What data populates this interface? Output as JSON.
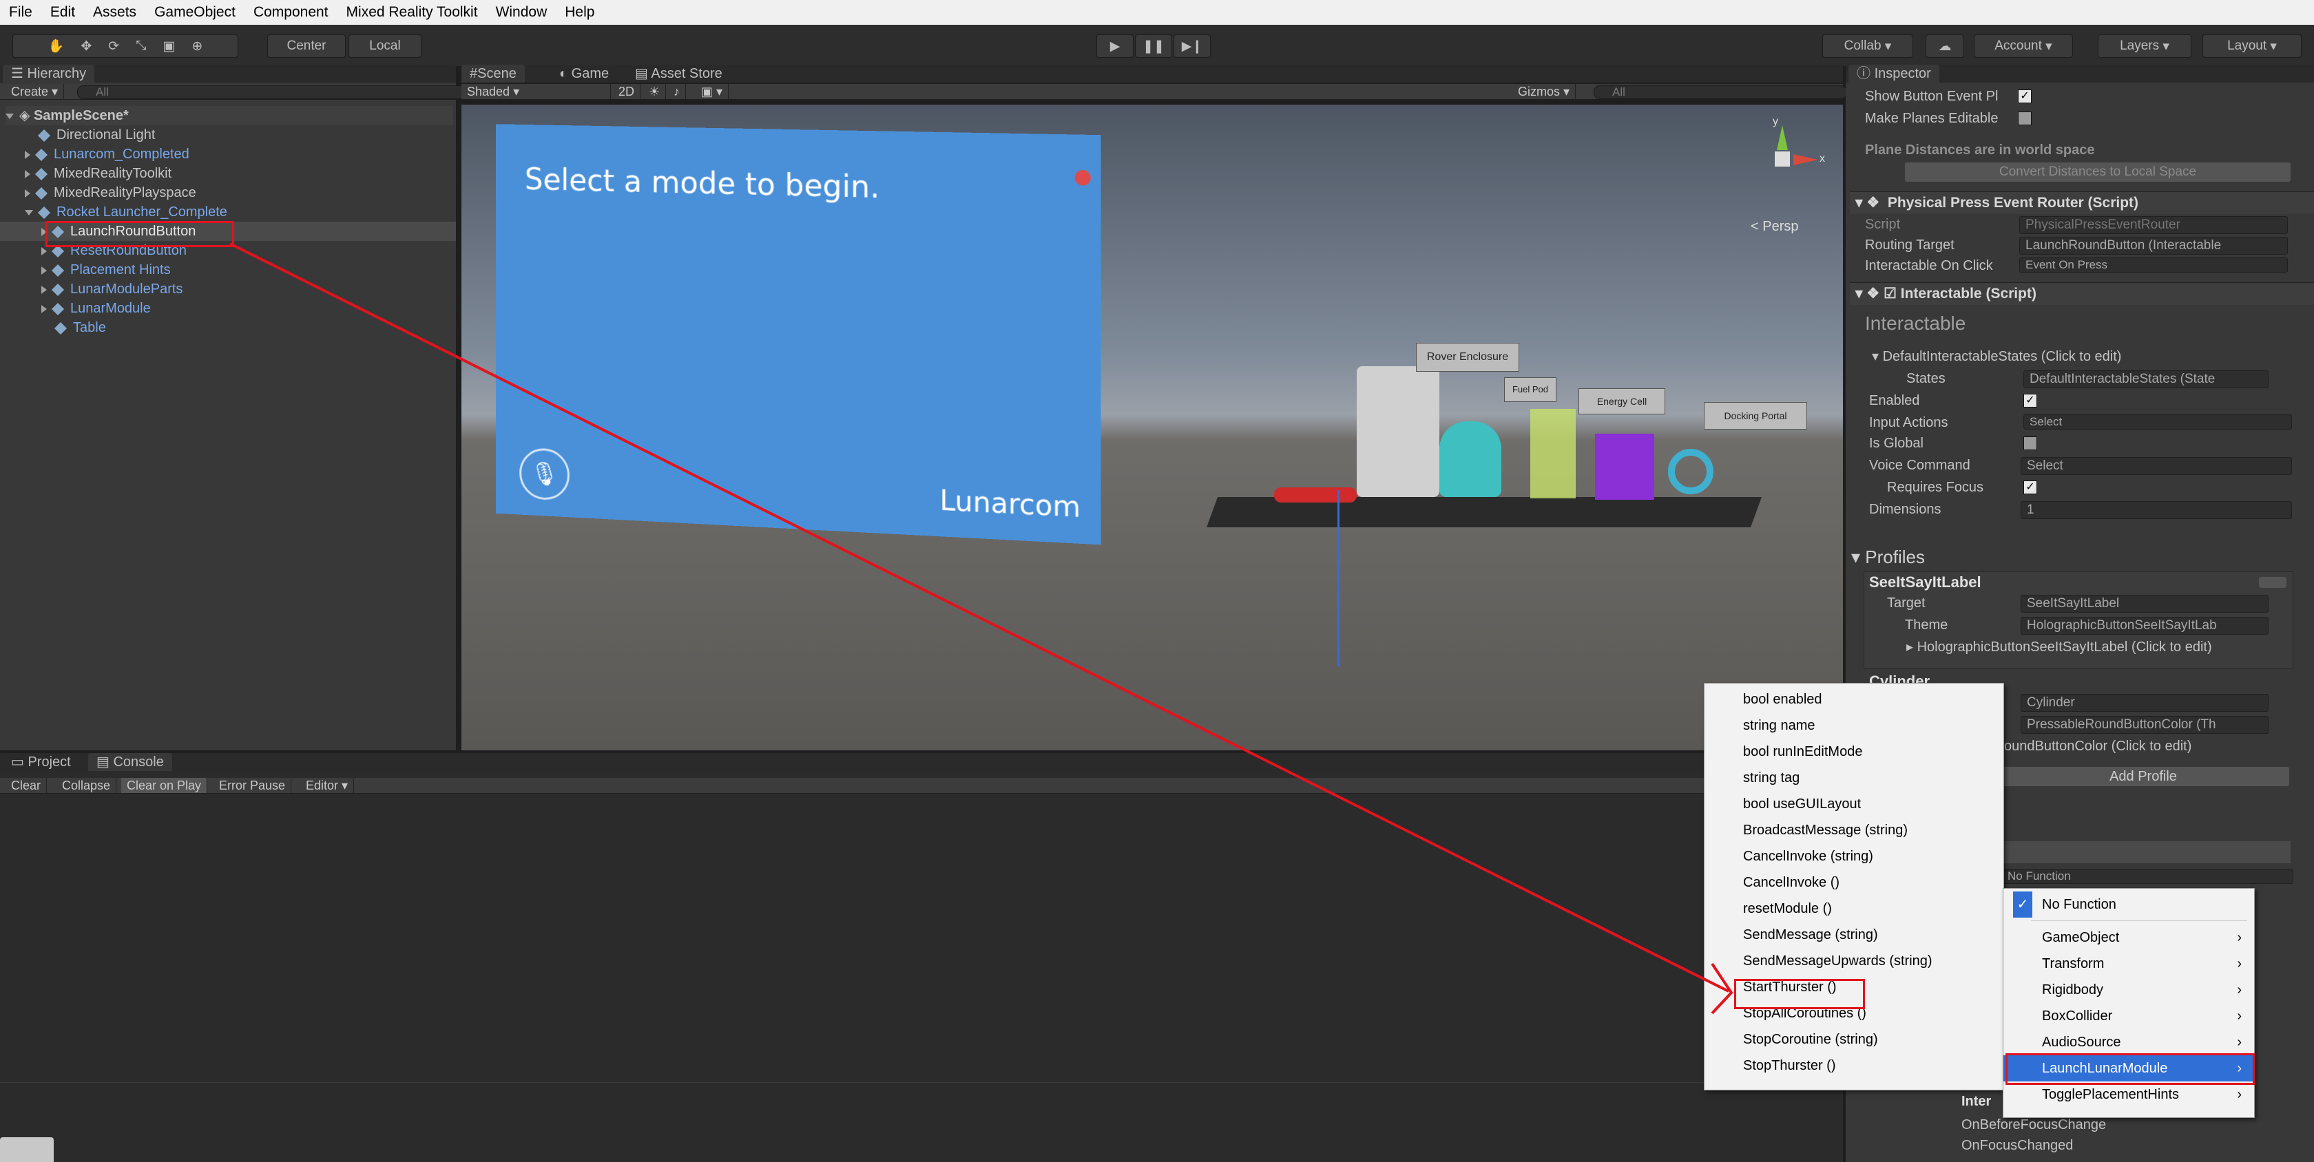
{
  "menubar": [
    "File",
    "Edit",
    "Assets",
    "GameObject",
    "Component",
    "Mixed Reality Toolkit",
    "Window",
    "Help"
  ],
  "toolbar": {
    "center": "Center",
    "local": "Local",
    "collab": "Collab",
    "account": "Account",
    "layers": "Layers",
    "layout": "Layout"
  },
  "hierarchy": {
    "tab": "Hierarchy",
    "create": "Create",
    "search": "All",
    "scene": "SampleScene*",
    "items": [
      {
        "label": "Directional Light"
      },
      {
        "label": "Lunarcom_Completed"
      },
      {
        "label": "MixedRealityToolkit"
      },
      {
        "label": "MixedRealityPlayspace"
      },
      {
        "label": "Rocket Launcher_Complete"
      },
      {
        "label": "LaunchRoundButton"
      },
      {
        "label": "ResetRoundButton"
      },
      {
        "label": "Placement Hints"
      },
      {
        "label": "LunarModuleParts"
      },
      {
        "label": "LunarModule"
      },
      {
        "label": "Table"
      }
    ]
  },
  "scene": {
    "tabs": [
      "Scene",
      "Game",
      "Asset Store"
    ],
    "shading": "Shaded",
    "mode2d": "2D",
    "gizmos": "Gizmos",
    "search": "All",
    "persp": "Persp",
    "panel_title": "Select a mode to begin.",
    "panel_brand": "Lunarcom",
    "labels": [
      "Rover Enclosure",
      "Fuel Pod",
      "Energy Cell",
      "Docking Portal"
    ],
    "gizmo_axes": [
      "y",
      "x"
    ]
  },
  "console": {
    "tabs": [
      "Project",
      "Console"
    ],
    "buttons": [
      "Clear",
      "Collapse",
      "Clear on Play",
      "Error Pause",
      "Editor"
    ]
  },
  "inspector": {
    "tab": "Inspector",
    "show_button": "Show Button Event Pl",
    "make_planes": "Make Planes Editable",
    "plane_note": "Plane Distances are in world space",
    "convert_btn": "Convert Distances to Local Space",
    "ppr_title": "Physical Press Event Router (Script)",
    "script_label": "Script",
    "script_value": "PhysicalPressEventRouter",
    "routing_label": "Routing Target",
    "routing_value": "LaunchRoundButton (Interactable",
    "ioc_label": "Interactable On Click",
    "ioc_value": "Event On Press",
    "inter_title": "Interactable (Script)",
    "inter_header": "Interactable",
    "states_fold": "DefaultInteractableStates (Click to edit)",
    "states_label": "States",
    "states_value": "DefaultInteractableStates (State",
    "enabled": "Enabled",
    "input_actions": "Input Actions",
    "input_value": "Select",
    "is_global": "Is Global",
    "voice": "Voice Command",
    "voice_value": "Select",
    "requires_focus": "Requires Focus",
    "dimensions": "Dimensions",
    "dimensions_value": "1",
    "profiles": "Profiles",
    "p1_name": "SeeItSayItLabel",
    "target_label": "Target",
    "p1_target": "SeeItSayItLabel",
    "theme_label": "Theme",
    "p1_theme": "HolographicButtonSeeItSayItLab",
    "p1_fold": "HolographicButtonSeeItSayItLabel (Click to edit)",
    "p2_name": "Cylinder",
    "p2_target": "Cylinder",
    "p2_theme": "PressableRoundButtonColor (Th",
    "p2_fold": "oundButtonColor (Click to edit)",
    "add_profile": "Add Profile",
    "no_function": "No Function",
    "events": [
      "OnBeforeFocusChange",
      "OnFocusChanged"
    ],
    "inter_trunc": "Inter"
  },
  "method_menu": [
    "bool enabled",
    "string name",
    "bool runInEditMode",
    "string tag",
    "bool useGUILayout",
    "BroadcastMessage (string)",
    "CancelInvoke (string)",
    "CancelInvoke ()",
    "resetModule ()",
    "SendMessage (string)",
    "SendMessageUpwards (string)",
    "StartThurster ()",
    "StopAllCoroutines ()",
    "StopCoroutine (string)",
    "StopThurster ()"
  ],
  "component_menu": [
    {
      "label": "No Function",
      "checked": true
    },
    {
      "label": "GameObject",
      "sub": true
    },
    {
      "label": "Transform",
      "sub": true
    },
    {
      "label": "Rigidbody",
      "sub": true
    },
    {
      "label": "BoxCollider",
      "sub": true
    },
    {
      "label": "AudioSource",
      "sub": true
    },
    {
      "label": "LaunchLunarModule",
      "sub": true,
      "selected": true
    },
    {
      "label": "TogglePlacementHints",
      "sub": true
    }
  ],
  "colors": {
    "accent": "#2f6fd6",
    "highlight": "#e0141e",
    "panel_blue": "#4a90d9"
  }
}
